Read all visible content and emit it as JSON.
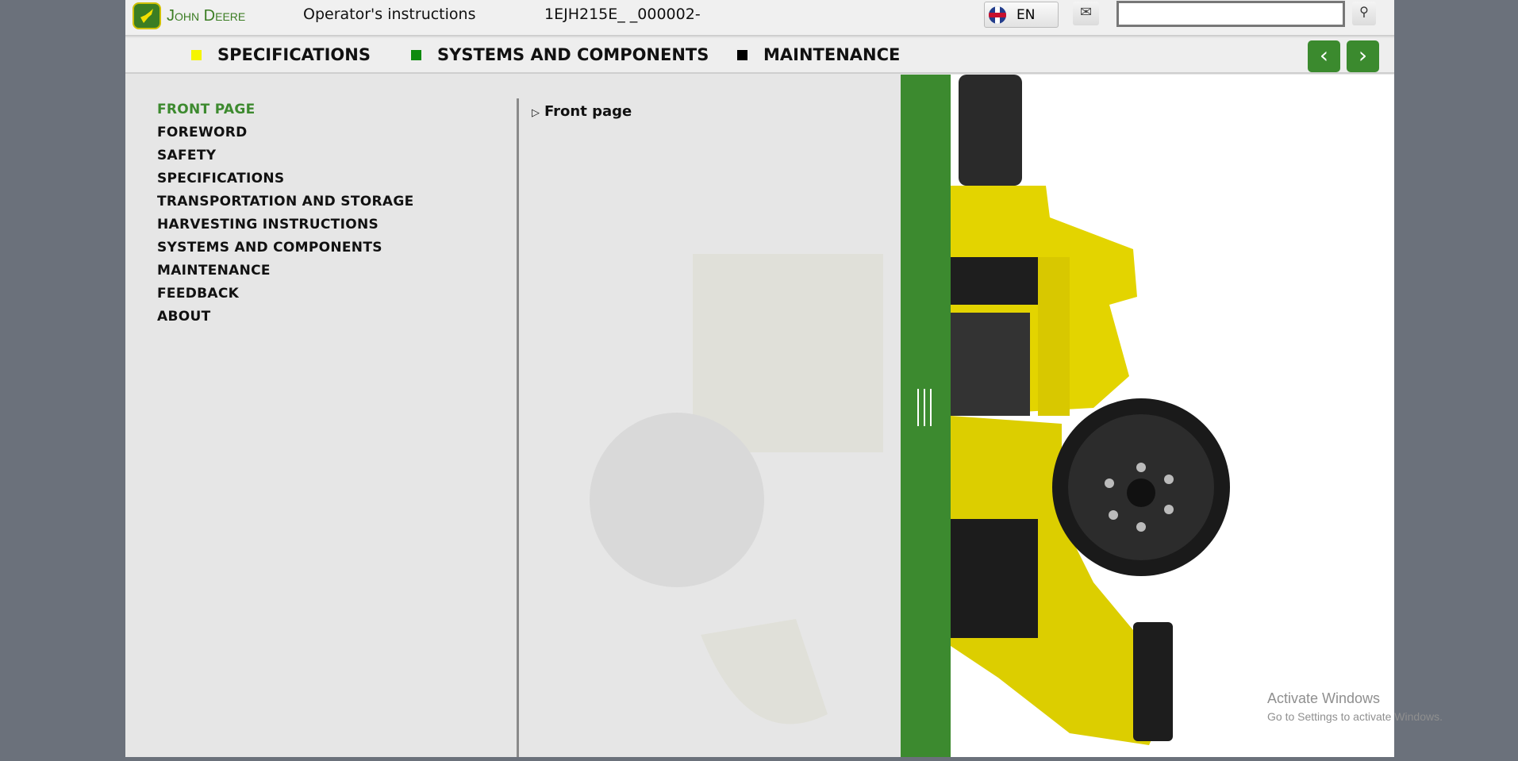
{
  "header": {
    "brand": "John Deere",
    "title": "Operator's instructions",
    "doc_id": "1EJH215E_ _000002-",
    "language": "EN",
    "search_value": "",
    "search_placeholder": ""
  },
  "nav": {
    "items": [
      {
        "label": "SPECIFICATIONS",
        "color": "#f5f500"
      },
      {
        "label": "SYSTEMS AND COMPONENTS",
        "color": "#0e8a0e"
      },
      {
        "label": "MAINTENANCE",
        "color": "#000000"
      }
    ],
    "prev": "‹",
    "next": "›"
  },
  "menu": {
    "items": [
      "FRONT PAGE",
      "FOREWORD",
      "SAFETY",
      "SPECIFICATIONS",
      "TRANSPORTATION AND STORAGE",
      "HARVESTING INSTRUCTIONS",
      "SYSTEMS AND COMPONENTS",
      "MAINTENANCE",
      "FEEDBACK",
      "ABOUT"
    ],
    "active": 0
  },
  "content": {
    "crumb": "Front page"
  },
  "watermark": {
    "line1": "Activate Windows",
    "line2": "Go to Settings to activate Windows."
  },
  "colors": {
    "accent": "#3c8a2f",
    "background": "#6b717b"
  }
}
